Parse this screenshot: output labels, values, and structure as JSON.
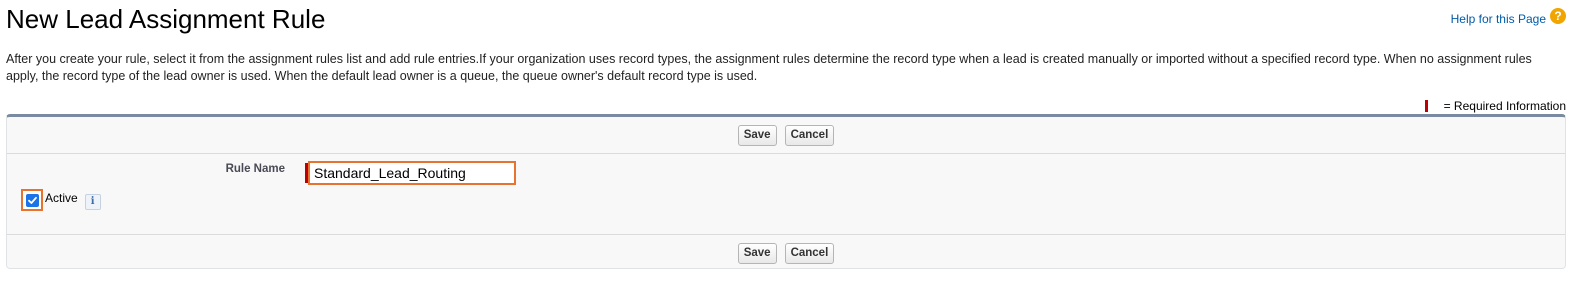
{
  "page": {
    "title": "New Lead Assignment Rule",
    "help_link": "Help for this Page",
    "help_icon": "help-question-icon",
    "description": "After you create your rule, select it from the assignment rules list and add rule entries.If your organization uses record types, the assignment rules determine the record type when a lead is created manually or imported without a specified record type. When no assignment rules apply, the record type of the lead owner is used. When the default lead owner is a queue, the queue owner's default record type is used.",
    "required_legend": "= Required Information"
  },
  "top_buttons": {
    "save": "Save",
    "cancel": "Cancel"
  },
  "form": {
    "rule_name_label": "Rule Name",
    "rule_name_value": "Standard_Lead_Routing",
    "active_label": "Active",
    "active_checked": true,
    "info_icon": "info-icon"
  },
  "bottom_buttons": {
    "save": "Save",
    "cancel": "Cancel"
  },
  "colors": {
    "required": "#c00000",
    "highlight": "#e8732f",
    "link": "#015ba7",
    "checkbox": "#1a73e8"
  }
}
